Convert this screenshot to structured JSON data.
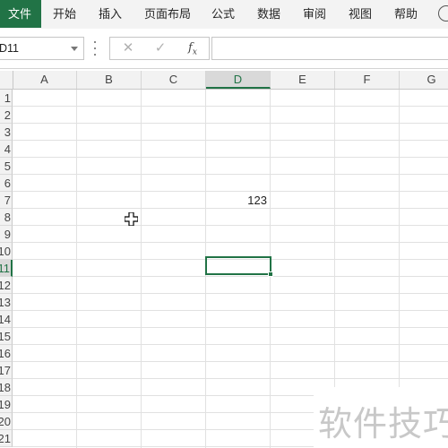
{
  "ribbon": {
    "tabs": [
      "文件",
      "开始",
      "插入",
      "页面布局",
      "公式",
      "数据",
      "审阅",
      "视图",
      "帮助"
    ]
  },
  "formula_bar": {
    "name_box_value": "D11",
    "cancel_icon": "cancel-icon",
    "enter_icon": "checkmark-icon",
    "fx_label": "fx",
    "formula_value": ""
  },
  "grid": {
    "columns": [
      "A",
      "B",
      "C",
      "D",
      "E",
      "F",
      "G"
    ],
    "active_column": "D",
    "rows": [
      "1",
      "2",
      "3",
      "4",
      "5",
      "6",
      "7",
      "8",
      "9",
      "10",
      "11",
      "12",
      "13",
      "14",
      "15",
      "16",
      "17",
      "18",
      "19",
      "20",
      "21"
    ],
    "active_row": "11",
    "cells": [
      {
        "ref": "D7",
        "value": "123"
      }
    ],
    "selected_cell": "D11"
  },
  "colors": {
    "accent": "#217346",
    "file_tab_bg": "#217346"
  },
  "watermark": "软件技巧"
}
